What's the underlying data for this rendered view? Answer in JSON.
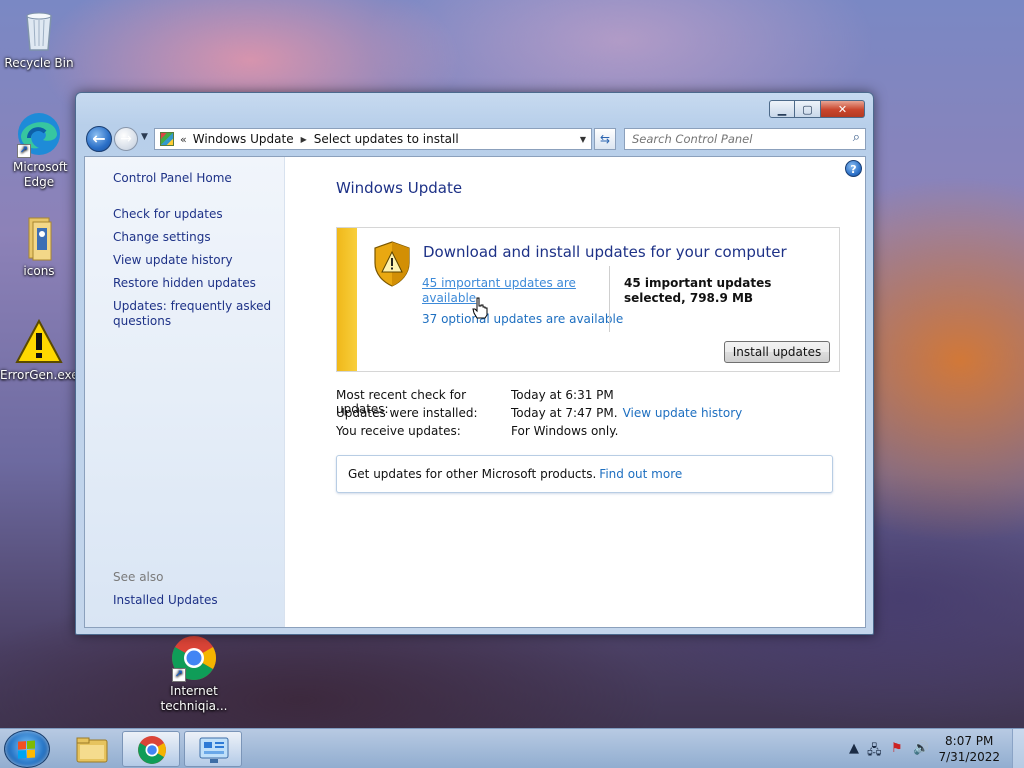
{
  "desktop": {
    "icons": [
      {
        "label": "Recycle Bin"
      },
      {
        "label": "Microsoft Edge"
      },
      {
        "label": "icons"
      },
      {
        "label": "ErrorGen.exe"
      },
      {
        "label": "Internet techniqia..."
      }
    ]
  },
  "window": {
    "breadcrumb": [
      "Windows Update",
      "Select updates to install"
    ],
    "breadcrumb_prefix": "«",
    "search_placeholder": "Search Control Panel",
    "left_pane": {
      "home": "Control Panel Home",
      "links": [
        "Check for updates",
        "Change settings",
        "View update history",
        "Restore hidden updates",
        "Updates: frequently asked questions"
      ],
      "see_also_heading": "See also",
      "see_also_links": [
        "Installed Updates"
      ]
    },
    "main": {
      "title": "Windows Update",
      "update_box": {
        "headline": "Download and install updates for your computer",
        "important_link": "45 important updates are available",
        "optional_link": "37 optional updates are available",
        "selected_summary": "45 important updates selected, 798.9 MB",
        "install_button": "Install updates"
      },
      "status": [
        {
          "label": "Most recent check for updates:",
          "value": "Today at 6:31 PM",
          "link": ""
        },
        {
          "label": "Updates were installed:",
          "value": "Today at 7:47 PM.",
          "link": "View update history"
        },
        {
          "label": "You receive updates:",
          "value": "For Windows only.",
          "link": ""
        }
      ],
      "other_products": {
        "text": "Get updates for other Microsoft products.",
        "link": "Find out more"
      }
    }
  },
  "taskbar": {
    "clock_time": "8:07 PM",
    "clock_date": "7/31/2022"
  },
  "icons": {
    "window_minimize": "minimize-icon",
    "window_maximize": "maximize-icon",
    "window_close": "close-icon",
    "help": "help-icon",
    "warning_shield": "shield-warning-icon"
  },
  "colors": {
    "link": "#1e6fc0",
    "heading": "#1e3287",
    "warning_stripe": "#f0b81a"
  }
}
